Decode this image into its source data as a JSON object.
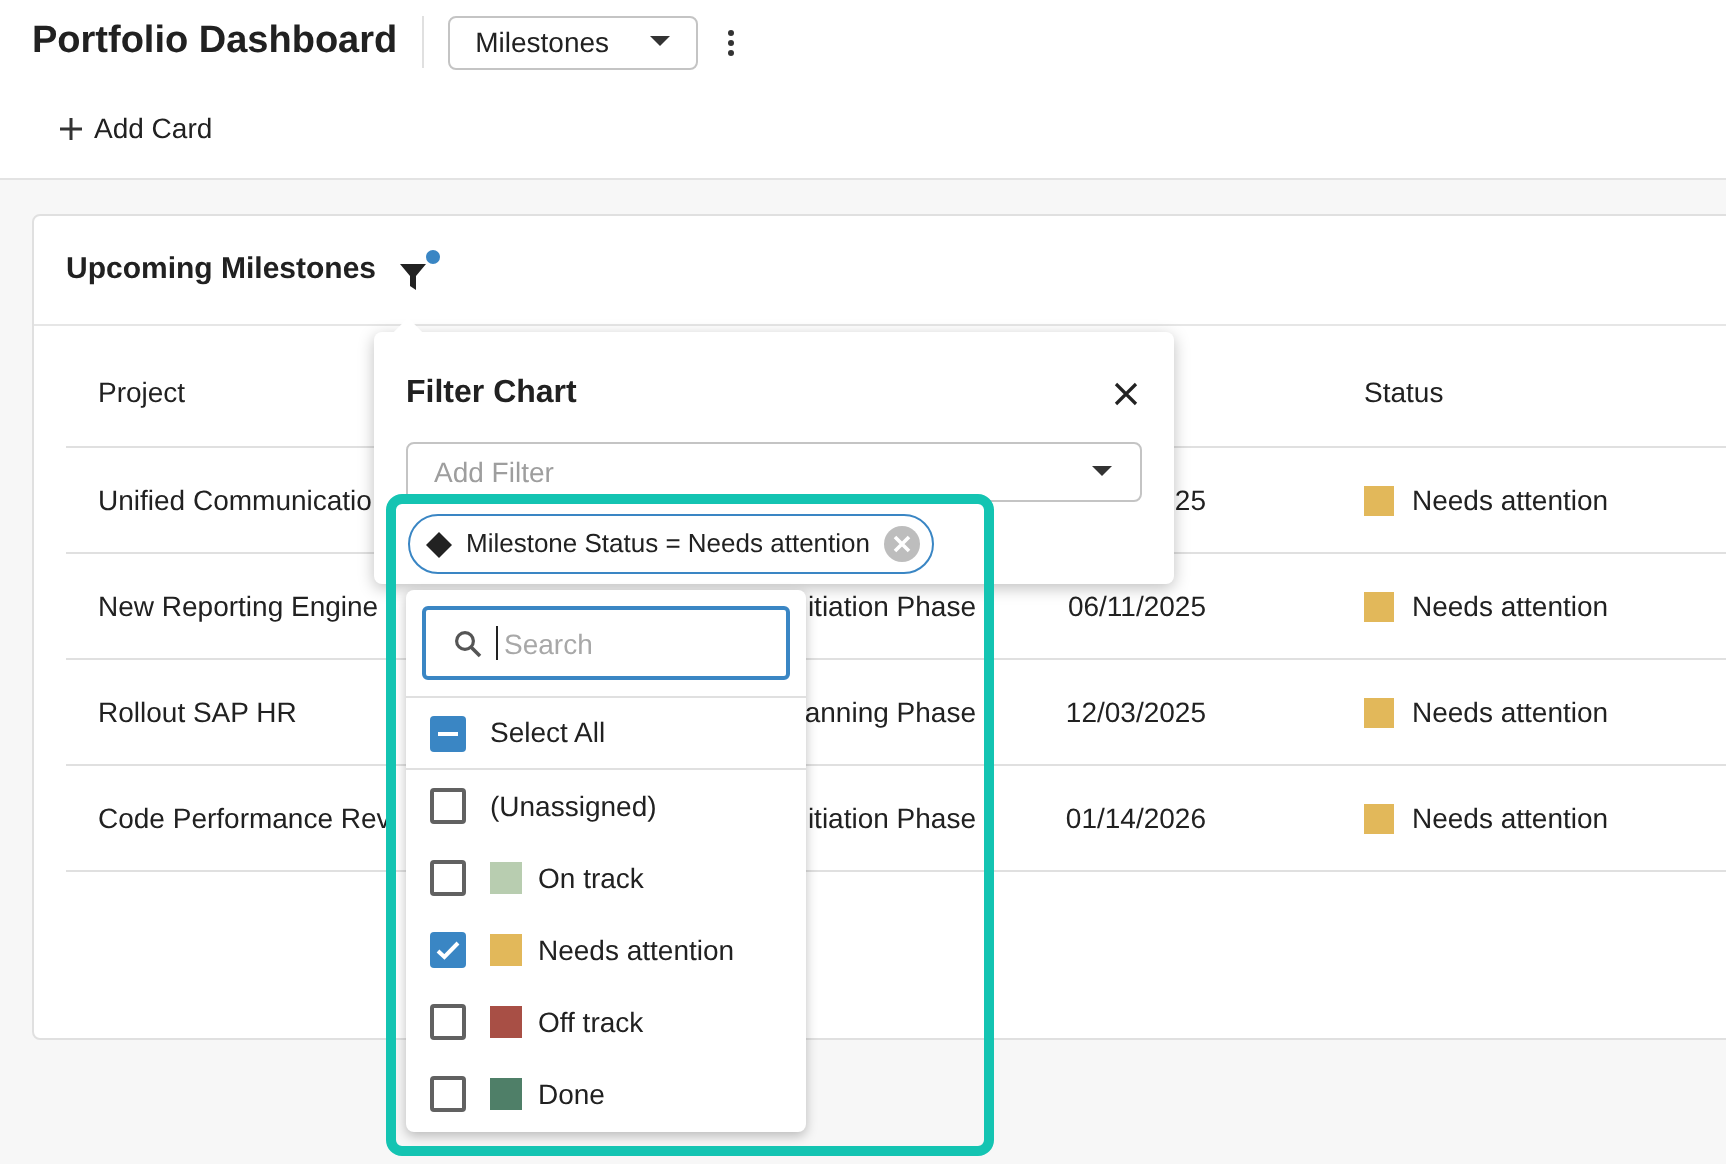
{
  "header": {
    "title": "Portfolio Dashboard",
    "view_select": {
      "value": "Milestones"
    }
  },
  "toolbar": {
    "add_card": "Add Card"
  },
  "card": {
    "title": "Upcoming Milestones",
    "filter_active": true,
    "table": {
      "columns": {
        "project": "Project",
        "status": "Status"
      },
      "rows": [
        {
          "project": "Unified Communicatio",
          "date": "25",
          "status": {
            "label": "Needs attention",
            "color": "#e2b85a"
          }
        },
        {
          "project": "New Reporting Engine",
          "column_2": "itiation Phase",
          "date": "06/11/2025",
          "status": {
            "label": "Needs attention",
            "color": "#e2b85a"
          }
        },
        {
          "project": "Rollout SAP HR",
          "column_2": "anning Phase",
          "date": "12/03/2025",
          "status": {
            "label": "Needs attention",
            "color": "#e2b85a"
          }
        },
        {
          "project": "Code Performance Rev",
          "column_2": "itiation Phase",
          "date": "01/14/2026",
          "status": {
            "label": "Needs attention",
            "color": "#e2b85a"
          }
        }
      ]
    }
  },
  "filter_popover": {
    "title": "Filter Chart",
    "add_filter": {
      "placeholder": "Add Filter"
    },
    "chips": [
      {
        "label": "Milestone Status = Needs attention"
      }
    ]
  },
  "value_dropdown": {
    "search": {
      "placeholder": "Search"
    },
    "select_all": {
      "label": "Select All",
      "indeterminate": true
    },
    "options": [
      {
        "label": "(Unassigned)",
        "checked": false
      },
      {
        "label": "On track",
        "checked": false,
        "color": "#b8cdb0"
      },
      {
        "label": "Needs attention",
        "checked": true,
        "color": "#e2b85a"
      },
      {
        "label": "Off track",
        "checked": false,
        "color": "#a84f45"
      },
      {
        "label": "Done",
        "checked": false,
        "color": "#4f7f68"
      }
    ]
  }
}
